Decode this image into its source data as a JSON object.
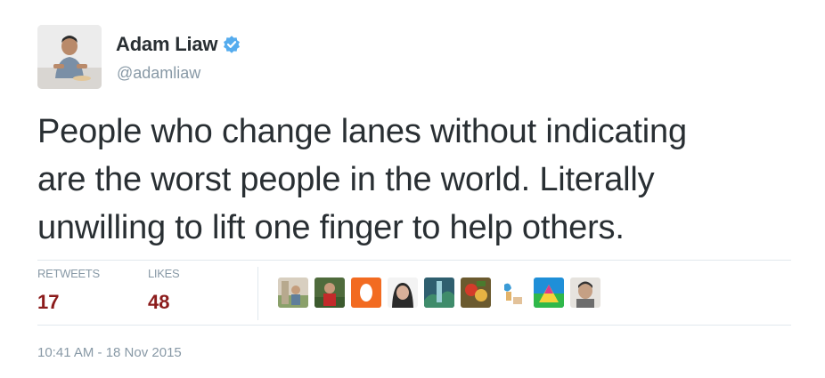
{
  "author": {
    "display_name": "Adam Liaw",
    "handle": "@adamliaw",
    "verified_icon": "verified-badge-icon",
    "verified_color": "#55acee"
  },
  "tweet": {
    "lines": [
      "People who change lanes without indicating",
      "are the worst people in the world. Literally",
      "unwilling to lift one finger to help others."
    ]
  },
  "stats": {
    "retweets_label": "RETWEETS",
    "retweets_count": "17",
    "likes_label": "LIKES",
    "likes_count": "48",
    "count_color": "#8c1c1c"
  },
  "favorited_by": [
    {
      "icon": "user-avatar-icon"
    },
    {
      "icon": "user-avatar-icon"
    },
    {
      "icon": "user-avatar-icon"
    },
    {
      "icon": "user-avatar-icon"
    },
    {
      "icon": "user-avatar-icon"
    },
    {
      "icon": "user-avatar-icon"
    },
    {
      "icon": "user-avatar-icon"
    },
    {
      "icon": "user-avatar-icon"
    },
    {
      "icon": "user-avatar-icon"
    },
    {
      "icon": "user-avatar-icon"
    }
  ],
  "timestamp": "10:41 AM - 18 Nov 2015"
}
